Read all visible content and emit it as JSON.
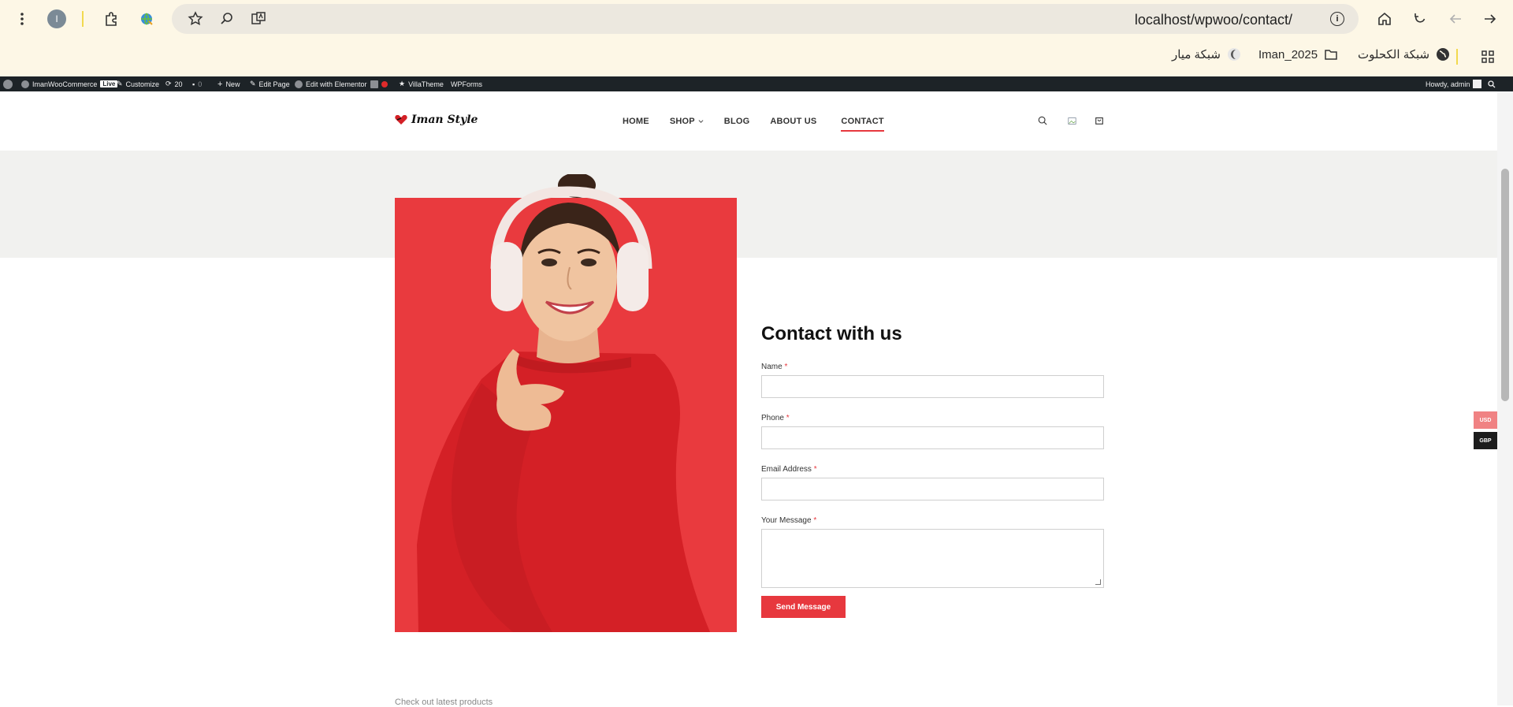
{
  "browser": {
    "url": "localhost/wpwoo/contact/",
    "profile_initial": "I",
    "bookmarks": [
      "شبكة الكحلوت",
      "Iman_2025",
      "شبكة ميار"
    ]
  },
  "adminbar": {
    "site_name": "ImanWooCommerce",
    "live": "Live",
    "customize": "Customize",
    "updates_count": "20",
    "comments_count": "0",
    "new": "New",
    "edit_page": "Edit Page",
    "edit_elementor": "Edit with Elementor",
    "villatheme": "VillaTheme",
    "wpforms": "WPForms",
    "howdy": "Howdy, admin"
  },
  "header": {
    "logo_text": "Iman Style",
    "nav": [
      "HOME",
      "SHOP",
      "BLOG",
      "ABOUT US",
      "CONTACT"
    ],
    "active_nav": "CONTACT"
  },
  "contact_form": {
    "title": "Contact with us",
    "fields": [
      {
        "label": "Name",
        "required": "*"
      },
      {
        "label": "Phone",
        "required": "*"
      },
      {
        "label": "Email Address",
        "required": "*"
      },
      {
        "label": "Your Message",
        "required": "*"
      }
    ],
    "submit_label": "Send Message"
  },
  "footer_teaser": "Check out latest products",
  "currency_switcher": {
    "items": [
      "USD",
      "GBP"
    ],
    "colors": {
      "usd": "#f08283",
      "gbp": "#1d1d1d"
    }
  },
  "theme": {
    "accent": "#e7383e",
    "chrome_bg": "#fdf7e6",
    "adminbar_bg": "#1d2327",
    "band_gray": "#f1f1ef"
  }
}
